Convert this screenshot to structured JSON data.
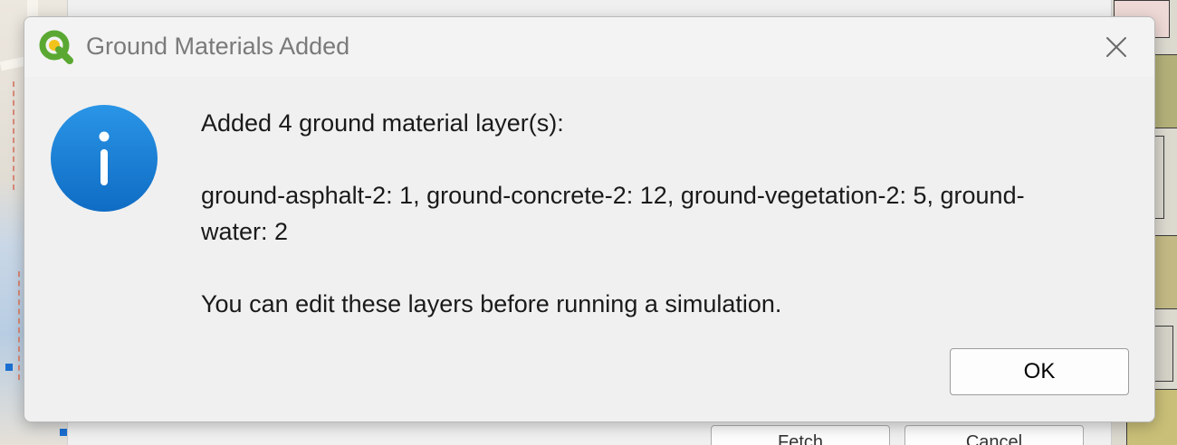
{
  "dialog": {
    "title": "Ground Materials Added",
    "app_icon": "qgis-logo-icon",
    "close_icon": "close-icon",
    "info_icon": "information-icon",
    "message": {
      "line1": "Added 4 ground material layer(s):",
      "line2": "ground-asphalt-2: 1, ground-concrete-2: 12, ground-vegetation-2: 5, ground-",
      "line3": "water: 2",
      "line4": "You can edit these layers before running a simulation."
    },
    "ok_label": "OK"
  },
  "parent_window": {
    "button1_label": "Fetch",
    "button2_label": "Cancel"
  },
  "colors": {
    "info_blue": "#1a7fd6",
    "qgis_green": "#5aa832",
    "qgis_yellow": "#f2c31b"
  }
}
